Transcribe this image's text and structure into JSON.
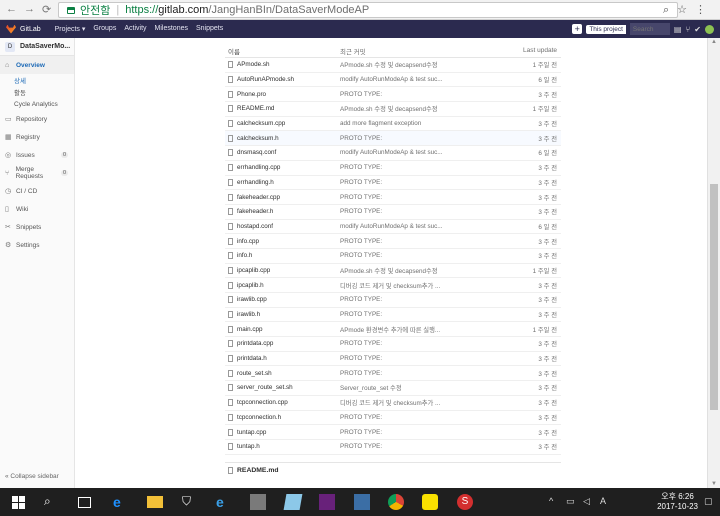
{
  "browser": {
    "secure_label": "안전함",
    "url_scheme": "https://",
    "url_host": "gitlab.com",
    "url_path": "/JangHanBIn/DataSaverModeAP"
  },
  "nav": {
    "brand": "GitLab",
    "items": [
      "Projects ▾",
      "Groups",
      "Activity",
      "Milestones",
      "Snippets"
    ],
    "this_project": "This project",
    "search_placeholder": "Search"
  },
  "sidebar": {
    "project_initial": "D",
    "project_name": "DataSaverMo...",
    "overview": "Overview",
    "overview_sub": [
      "상세",
      "활동",
      "Cycle Analytics"
    ],
    "items": [
      {
        "label": "Repository",
        "badge": ""
      },
      {
        "label": "Registry",
        "badge": ""
      },
      {
        "label": "Issues",
        "badge": "0"
      },
      {
        "label": "Merge Requests",
        "badge": "0"
      },
      {
        "label": "CI / CD",
        "badge": ""
      },
      {
        "label": "Wiki",
        "badge": ""
      },
      {
        "label": "Snippets",
        "badge": ""
      },
      {
        "label": "Settings",
        "badge": ""
      }
    ],
    "collapse": "Collapse sidebar"
  },
  "table": {
    "headers": [
      "이름",
      "최근 커밋",
      "Last update"
    ],
    "rows": [
      {
        "name": "APmode.sh",
        "msg": "APmode.sh 수정 및 decapsend수정",
        "date": "1 주일 전"
      },
      {
        "name": "AutoRunAPmode.sh",
        "msg": "modify AutoRunModeAp & test suc...",
        "date": "6 일 전"
      },
      {
        "name": "Phone.pro",
        "msg": "PROTO TYPE:",
        "date": "3 주 전"
      },
      {
        "name": "README.md",
        "msg": "APmode.sh 수정 및 decapsend수정",
        "date": "1 주일 전"
      },
      {
        "name": "calchecksum.cpp",
        "msg": "add more flagment exception",
        "date": "3 주 전"
      },
      {
        "name": "calchecksum.h",
        "msg": "PROTO TYPE:",
        "date": "3 주 전"
      },
      {
        "name": "dnsmasq.conf",
        "msg": "modify AutoRunModeAp & test suc...",
        "date": "6 일 전"
      },
      {
        "name": "errhandling.cpp",
        "msg": "PROTO TYPE:",
        "date": "3 주 전"
      },
      {
        "name": "errhandling.h",
        "msg": "PROTO TYPE:",
        "date": "3 주 전"
      },
      {
        "name": "fakeheader.cpp",
        "msg": "PROTO TYPE:",
        "date": "3 주 전"
      },
      {
        "name": "fakeheader.h",
        "msg": "PROTO TYPE:",
        "date": "3 주 전"
      },
      {
        "name": "hostapd.conf",
        "msg": "modify AutoRunModeAp & test suc...",
        "date": "6 일 전"
      },
      {
        "name": "info.cpp",
        "msg": "PROTO TYPE:",
        "date": "3 주 전"
      },
      {
        "name": "info.h",
        "msg": "PROTO TYPE:",
        "date": "3 주 전"
      },
      {
        "name": "ipcaplib.cpp",
        "msg": "APmode.sh 수정 및 decapsend수정",
        "date": "1 주일 전"
      },
      {
        "name": "ipcaplib.h",
        "msg": "디버깅 코드 제거 및 checksum추가 ...",
        "date": "3 주 전"
      },
      {
        "name": "irawlib.cpp",
        "msg": "PROTO TYPE:",
        "date": "3 주 전"
      },
      {
        "name": "irawlib.h",
        "msg": "PROTO TYPE:",
        "date": "3 주 전"
      },
      {
        "name": "main.cpp",
        "msg": "APmode 환경변수 추가에 따른 실행...",
        "date": "1 주일 전"
      },
      {
        "name": "printdata.cpp",
        "msg": "PROTO TYPE:",
        "date": "3 주 전"
      },
      {
        "name": "printdata.h",
        "msg": "PROTO TYPE:",
        "date": "3 주 전"
      },
      {
        "name": "route_set.sh",
        "msg": "PROTO TYPE:",
        "date": "3 주 전"
      },
      {
        "name": "server_route_set.sh",
        "msg": "Server_route_set 수정",
        "date": "3 주 전"
      },
      {
        "name": "tcpconnection.cpp",
        "msg": "디버깅 코드 제거 및 checksum추가 ...",
        "date": "3 주 전"
      },
      {
        "name": "tcpconnection.h",
        "msg": "PROTO TYPE:",
        "date": "3 주 전"
      },
      {
        "name": "tuntap.cpp",
        "msg": "PROTO TYPE:",
        "date": "3 주 전"
      },
      {
        "name": "tuntap.h",
        "msg": "PROTO TYPE:",
        "date": "3 주 전"
      }
    ],
    "readme_label": "README.md"
  },
  "taskbar": {
    "time": "오후 6:26",
    "date": "2017-10-23",
    "ime": "A"
  }
}
